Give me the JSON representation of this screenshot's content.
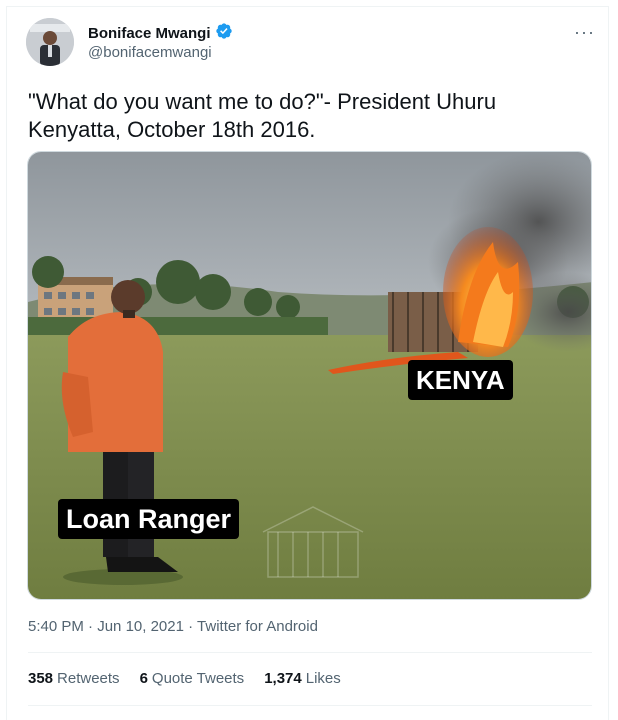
{
  "user": {
    "display_name": "Boniface Mwangi",
    "handle": "@bonifacemwangi",
    "verified": true
  },
  "more_menu": "···",
  "tweet": {
    "text": "\"What do you want me to do?\"- President Uhuru\nKenyatta, October 18th 2016."
  },
  "media": {
    "caption_kenya": "KENYA",
    "caption_loan": "Loan Ranger"
  },
  "meta": {
    "time": "5:40 PM",
    "sep1": "·",
    "date": "Jun 10, 2021",
    "sep2": "·",
    "source": "Twitter for Android"
  },
  "stats": {
    "retweets_count": "358",
    "retweets_label": "Retweets",
    "quotes_count": "6",
    "quotes_label": "Quote Tweets",
    "likes_count": "1,374",
    "likes_label": "Likes"
  },
  "colors": {
    "verified_blue": "#1d9bf0",
    "text_secondary": "#536471"
  }
}
